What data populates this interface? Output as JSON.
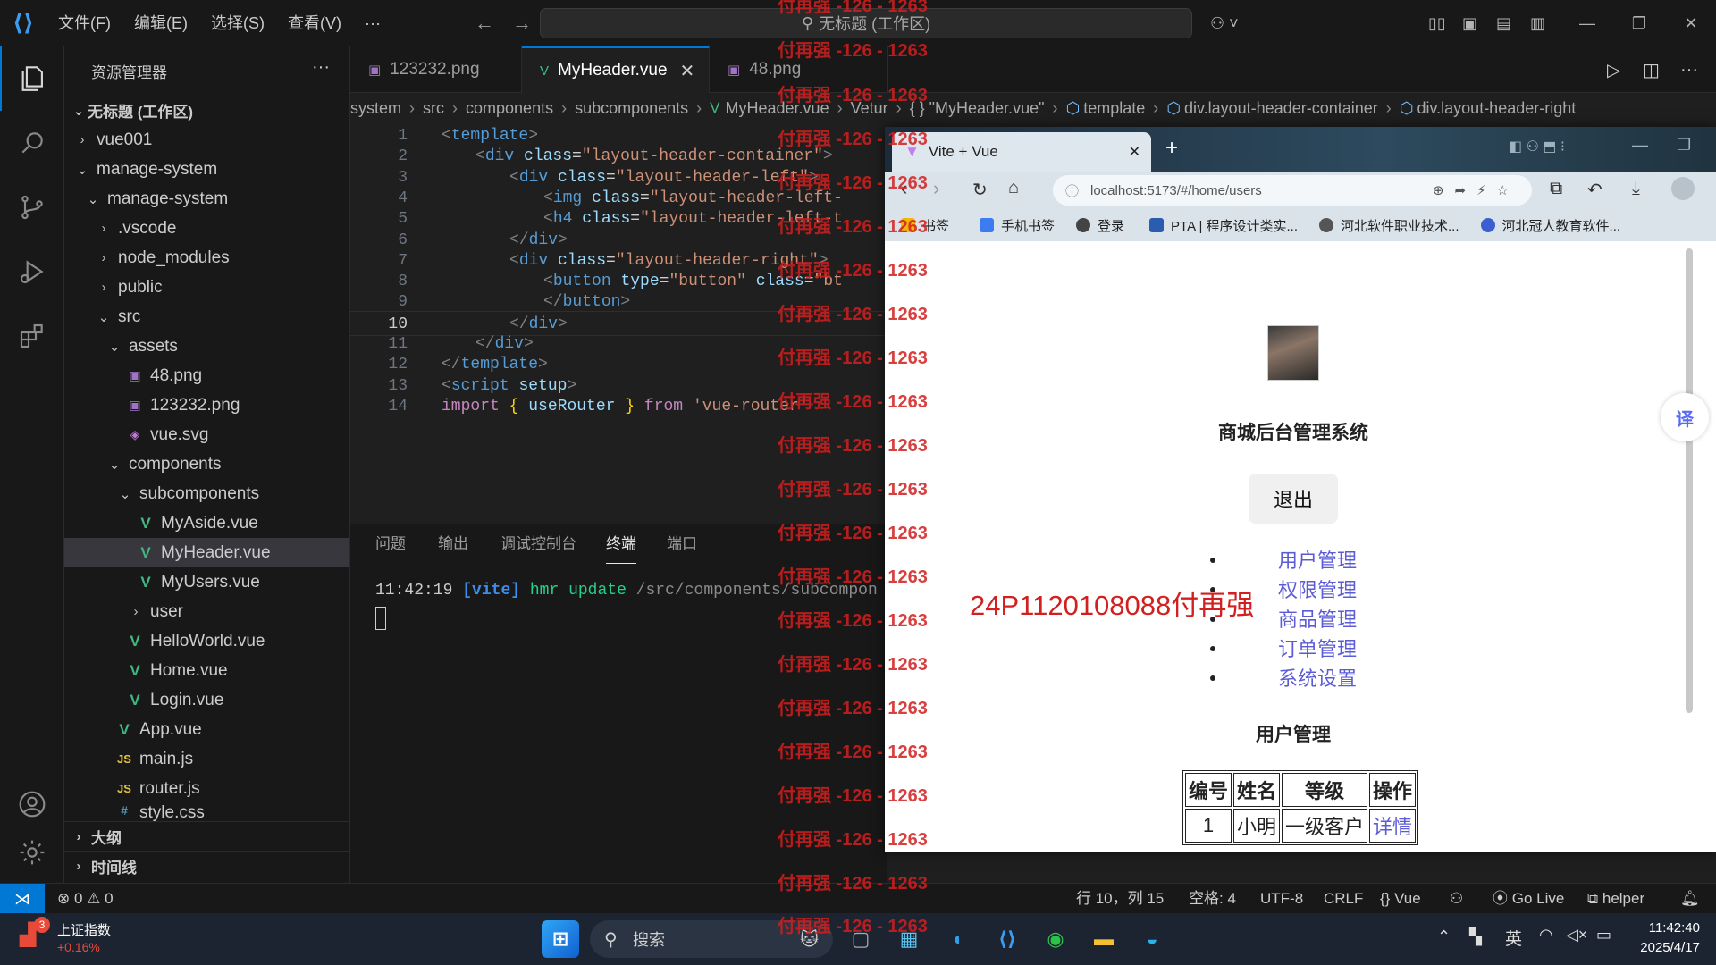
{
  "titlebar": {
    "menus": [
      "文件(F)",
      "编辑(E)",
      "选择(S)",
      "查看(V)",
      "···"
    ],
    "search_text": "无标题 (工作区)",
    "copilot_icon": "copilot-icon"
  },
  "sidebar": {
    "title": "资源管理器",
    "workspace": "无标题 (工作区)",
    "items": [
      {
        "label": "vue001"
      },
      {
        "label": "manage-system"
      },
      {
        "label": "manage-system"
      },
      {
        "label": ".vscode"
      },
      {
        "label": "node_modules"
      },
      {
        "label": "public"
      },
      {
        "label": "src"
      },
      {
        "label": "assets"
      },
      {
        "label": "48.png"
      },
      {
        "label": "123232.png"
      },
      {
        "label": "vue.svg"
      },
      {
        "label": "components"
      },
      {
        "label": "subcomponents"
      },
      {
        "label": "MyAside.vue"
      },
      {
        "label": "MyHeader.vue"
      },
      {
        "label": "MyUsers.vue"
      },
      {
        "label": "user"
      },
      {
        "label": "HelloWorld.vue"
      },
      {
        "label": "Home.vue"
      },
      {
        "label": "Login.vue"
      },
      {
        "label": "App.vue"
      },
      {
        "label": "main.js"
      },
      {
        "label": "router.js"
      },
      {
        "label": "style.css"
      }
    ],
    "sections": [
      "大纲",
      "时间线"
    ]
  },
  "tabs": [
    {
      "label": "123232.png"
    },
    {
      "label": "MyHeader.vue"
    },
    {
      "label": "48.png"
    }
  ],
  "breadcrumb": [
    "system",
    "src",
    "components",
    "subcomponents",
    "MyHeader.vue",
    "Vetur",
    "{ } \"MyHeader.vue\"",
    "template",
    "div.layout-header-container",
    "div.layout-header-right"
  ],
  "code": {
    "line_numbers": [
      "1",
      "2",
      "3",
      "4",
      "5",
      "6",
      "7",
      "8",
      "9",
      "10",
      "11",
      "12",
      "13",
      "14"
    ],
    "current_line": "10",
    "l1": "<template>",
    "l2_tag": "div",
    "l2_attr": "class",
    "l2_val": "\"layout-header-container\"",
    "l3_tag": "div",
    "l3_attr": "class",
    "l3_val": "\"layout-header-left\"",
    "l4_tag": "img",
    "l4_attr": "class",
    "l4_val": "\"layout-header-left-",
    "l5_tag": "h4",
    "l5_attr": "class",
    "l5_val": "\"layout-header-left-t",
    "l6_tag": "div",
    "l7_tag": "div",
    "l7_attr": "class",
    "l7_val": "\"layout-header-right\"",
    "l8_tag": "button",
    "l8_attr": "type",
    "l8_val": "\"button\"",
    "l8_attr2": "class",
    "l8_val2": "\"bt",
    "l9_tag": "button",
    "l10_tag": "div",
    "l11_tag": "div",
    "l12_tag": "template",
    "l13_tag": "script",
    "l13_attr": "setup",
    "l14_kw": "import",
    "l14_fn": "useRouter",
    "l14_from": "from",
    "l14_str": "'vue-router'"
  },
  "panel": {
    "tabs": [
      "问题",
      "输出",
      "调试控制台",
      "终端",
      "端口"
    ],
    "active_tab": "终端",
    "term_time": "11:42:19",
    "term_tag": "[vite]",
    "term_msg": "hmr update",
    "term_path": "/src/components/subcompon"
  },
  "browser": {
    "tab_title": "Vite + Vue",
    "url": "localhost:5173/#/home/users",
    "bookmarks": [
      "书签",
      "手机书签",
      "登录",
      "PTA | 程序设计类实...",
      "河北软件职业技术...",
      "河北冠人教育软件..."
    ],
    "page": {
      "site_title": "商城后台管理系统",
      "logout_label": "退出",
      "menu": [
        "用户管理",
        "权限管理",
        "商品管理",
        "订单管理",
        "系统设置"
      ],
      "section_title": "用户管理",
      "table_headers": [
        "编号",
        "姓名",
        "等级",
        "操作"
      ],
      "table_rows": [
        [
          "1",
          "小明",
          "一级客户",
          "详情"
        ]
      ]
    },
    "translate_label": "译"
  },
  "statusbar": {
    "problems": "⊗ 0 ⚠ 0",
    "position": "行 10，列 15",
    "spaces": "空格: 4",
    "encoding": "UTF-8",
    "eol": "CRLF",
    "language": "{} Vue",
    "golive": "Go Live",
    "helper": "helper"
  },
  "taskbar": {
    "stock_name": "上证指数",
    "stock_change": "+0.16%",
    "stock_badge": "3",
    "search_label": "搜索",
    "ime": "英",
    "time": "11:42:40",
    "date": "2025/4/17"
  },
  "watermarks": {
    "line": "付再强 -126 - 1263",
    "short": "1263",
    "big": "24P1120108088付再强"
  },
  "colors": {
    "accent": "#0078d4",
    "vue_green": "#41b883",
    "link": "#5b5bd6",
    "watermark": "#d21f1f"
  }
}
